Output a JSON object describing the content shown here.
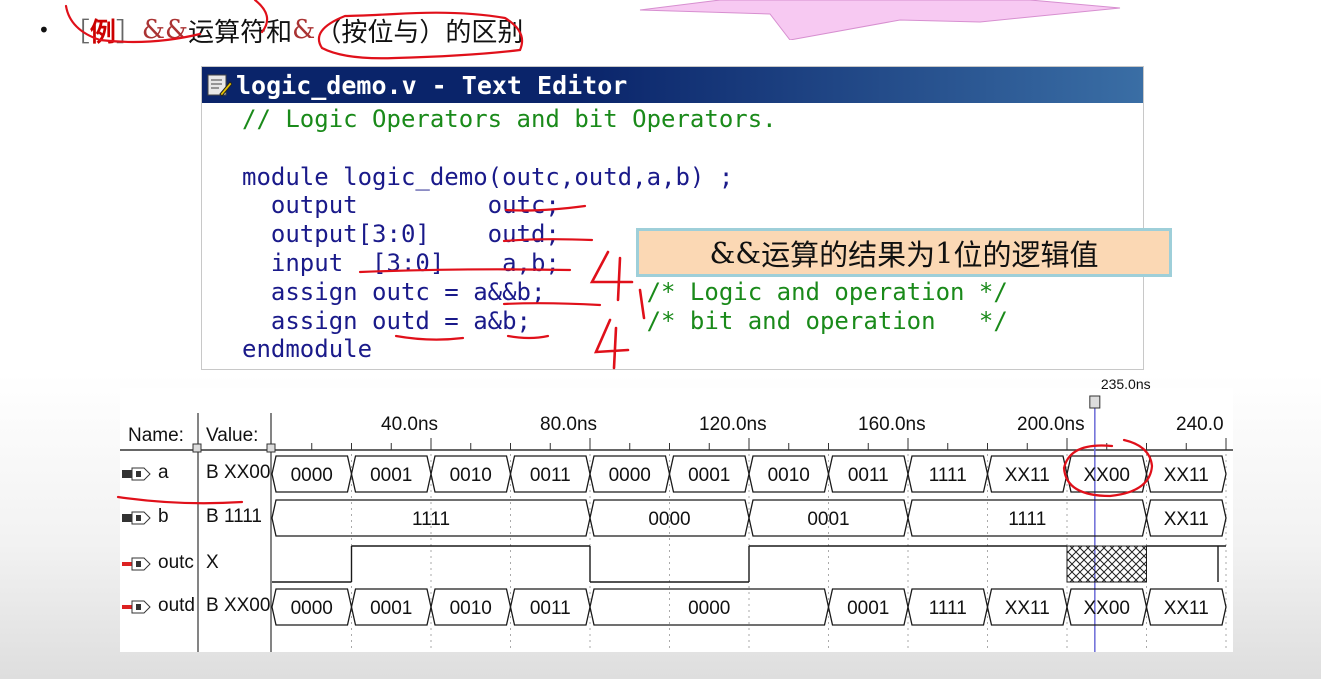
{
  "heading": {
    "bullet": "•",
    "bracket_open": "［",
    "example": "例",
    "bracket_close": "］",
    "part1_op": "&&",
    "part1_text": "运算符和",
    "part2_op": "&",
    "part2_text": "（按位与）",
    "part3_text": "的区别"
  },
  "editor": {
    "title": "logic_demo.v - Text Editor",
    "lines": [
      {
        "text": "// Logic Operators and bit Operators.",
        "comment": true
      },
      {
        "text": "",
        "comment": false
      },
      {
        "text": "module logic_demo(outc,outd,a,b) ;",
        "comment": false
      },
      {
        "text": "  output         outc;",
        "comment": false
      },
      {
        "text": "  output[3:0]    outd;",
        "comment": false
      },
      {
        "text": "  input  [3:0]    a,b;",
        "comment": false
      },
      {
        "text": "  assign outc = a&&b;",
        "comment": false,
        "tail": "       /* Logic and operation */"
      },
      {
        "text": "  assign outd = a&b;",
        "comment": false,
        "tail": "        /* bit and operation   */"
      },
      {
        "text": "endmodule",
        "comment": false
      }
    ]
  },
  "callout": {
    "op": "&&",
    "text_a": "运算的结果为",
    "num": "1",
    "text_b": "位的逻辑值"
  },
  "waveform": {
    "name_header": "Name:",
    "value_header": "Value:",
    "cursor_label": "235.0ns",
    "time_labels": [
      {
        "t": 40,
        "label": "40.0ns"
      },
      {
        "t": 80,
        "label": "80.0ns"
      },
      {
        "t": 120,
        "label": "120.0ns"
      },
      {
        "t": 160,
        "label": "160.0ns"
      },
      {
        "t": 200,
        "label": "200.0ns"
      },
      {
        "t": 240,
        "label": "240.0"
      }
    ],
    "signals": [
      {
        "name": "a",
        "value": "B XX00",
        "icon": "input-pin-icon",
        "kind": "bus",
        "segments": [
          [
            "0000",
            0,
            20
          ],
          [
            "0001",
            20,
            40
          ],
          [
            "0010",
            40,
            60
          ],
          [
            "0011",
            60,
            80
          ],
          [
            "0000",
            80,
            100
          ],
          [
            "0001",
            100,
            120
          ],
          [
            "0010",
            120,
            140
          ],
          [
            "0011",
            140,
            160
          ],
          [
            "1111",
            160,
            180
          ],
          [
            "XX11",
            180,
            200
          ],
          [
            "XX00",
            200,
            220
          ],
          [
            "XX11",
            220,
            240
          ]
        ]
      },
      {
        "name": "b",
        "value": "B 1111",
        "icon": "input-pin-icon",
        "kind": "bus",
        "segments": [
          [
            "1111",
            0,
            80
          ],
          [
            "0000",
            80,
            120
          ],
          [
            "0001",
            120,
            160
          ],
          [
            "1111",
            160,
            220
          ],
          [
            "XX11",
            220,
            240
          ]
        ]
      },
      {
        "name": "outc",
        "value": "X",
        "icon": "output-pin-icon",
        "kind": "bit",
        "segments": [
          [
            "0",
            0,
            20
          ],
          [
            "1",
            20,
            80
          ],
          [
            "0",
            80,
            120
          ],
          [
            "1",
            120,
            200
          ],
          [
            "X",
            200,
            220
          ],
          [
            "1",
            220,
            240
          ]
        ]
      },
      {
        "name": "outd",
        "value": "B XX00",
        "icon": "output-bus-icon",
        "kind": "bus",
        "segments": [
          [
            "0000",
            0,
            20
          ],
          [
            "0001",
            20,
            40
          ],
          [
            "0010",
            40,
            60
          ],
          [
            "0011",
            60,
            80
          ],
          [
            "0000",
            80,
            140
          ],
          [
            "0001",
            140,
            160
          ],
          [
            "1111",
            160,
            180
          ],
          [
            "XX11",
            180,
            200
          ],
          [
            "XX00",
            200,
            220
          ],
          [
            "XX11",
            220,
            240
          ]
        ]
      }
    ],
    "cursor_time": 207
  },
  "annotations": {
    "widths": [
      "4",
      "1",
      "4"
    ]
  },
  "colors": {
    "code_text": "#1a1a8a",
    "comment_text": "#1a8a1a",
    "ink_red": "#e0101a",
    "title_bar": "#0a246a",
    "callout_bg": "#fbd8b4",
    "wave_line": "#1a1a1a",
    "cursor": "#6b6bd8"
  }
}
